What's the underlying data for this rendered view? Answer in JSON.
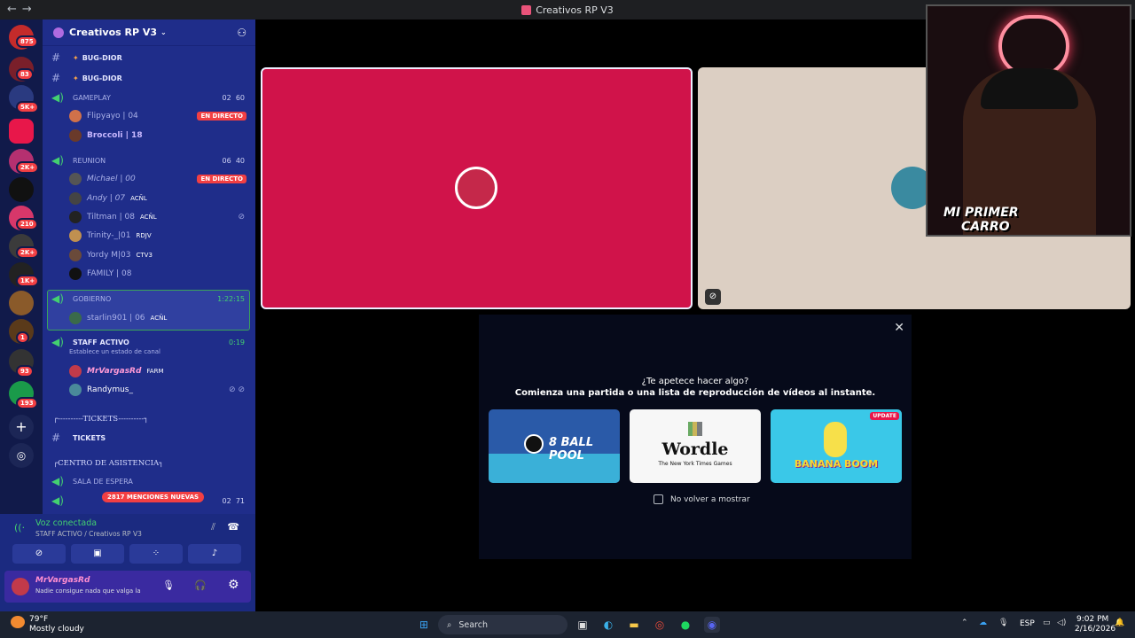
{
  "window": {
    "title": "Creativos RP V3"
  },
  "servers": [
    {
      "badge": "875"
    },
    {
      "badge": "83"
    },
    {
      "badge": "5K+"
    },
    {
      "badge": ""
    },
    {
      "badge": "2K+"
    },
    {
      "badge": ""
    },
    {
      "badge": "210"
    },
    {
      "badge": "2K+"
    },
    {
      "badge": "1K+"
    },
    {
      "badge": ""
    },
    {
      "badge": "1"
    },
    {
      "badge": "93"
    },
    {
      "badge": "193"
    }
  ],
  "sidebar": {
    "server_name": "Creativos RP V3",
    "channels": {
      "bug1": "BUG-DIOR",
      "bug2": "BUG-DIOR",
      "gameplay": "GAMEPLAY",
      "gameplay_count_a": "02",
      "gameplay_count_b": "60",
      "reunion": "REUNION",
      "reunion_count_a": "06",
      "reunion_count_b": "40",
      "gobierno": "GOBIERNO",
      "gobierno_time": "1:22:15",
      "staff": "STAFF ACTIVO",
      "staff_time": "0:19",
      "staff_status": "Establece un estado de canal",
      "tickets_cat": "┌----------TICKETS----------┐",
      "tickets": "TICKETS",
      "centro_cat": "┌CENTRO DE ASISTENCIA┐",
      "sala": "SALA DE ESPERA",
      "last_count_a": "02",
      "last_count_b": "71"
    },
    "users": {
      "flipyayo": "Flipyayo | 04",
      "broccoli": "Broccoli  | 18",
      "michael": "Michael | 00",
      "andy": "Andy | 07",
      "andy_tag": "ACÑL",
      "tiltman": "Tiltman | 08",
      "tiltman_tag": "ACÑL",
      "trinity": "Trinity-_|01",
      "trinity_tag": "RDJV",
      "yordy": "Yordy M|03",
      "yordy_tag": "CTV3",
      "family": "FAMILY | 08",
      "starlin": "starlin901 | 06",
      "starlin_tag": "ACÑL",
      "vargas": "MrVargasRd",
      "vargas_tag": "FARM",
      "randymus": "Randymus_"
    },
    "live_label": "EN DIRECTO",
    "mentions": "2817 MENCIONES NUEVAS"
  },
  "voice": {
    "status": "Voz conectada",
    "channel": "STAFF ACTIVO / Creativos RP V3",
    "username": "MrVargasRd",
    "user_status": "Nadie consigue nada que valga la"
  },
  "activity": {
    "question": "¿Te apetece hacer algo?",
    "subtitle": "Comienza una partida o una lista de reproducción de vídeos al instante.",
    "games": [
      {
        "name": "8 BALL POOL"
      },
      {
        "name": "Wordle",
        "sub": "The New York Times Games"
      },
      {
        "name": "BANANA BOOM",
        "badge": "UPDATE"
      }
    ],
    "checkbox_label": "No volver a mostrar"
  },
  "webcam": {
    "caption1": "MI PRIMER",
    "caption2": "CARRO"
  },
  "taskbar": {
    "weather_temp": "79°F",
    "weather_desc": "Mostly cloudy",
    "search": "Search",
    "lang": "ESP",
    "time": "9:02 PM",
    "date": "2/16/2026"
  }
}
